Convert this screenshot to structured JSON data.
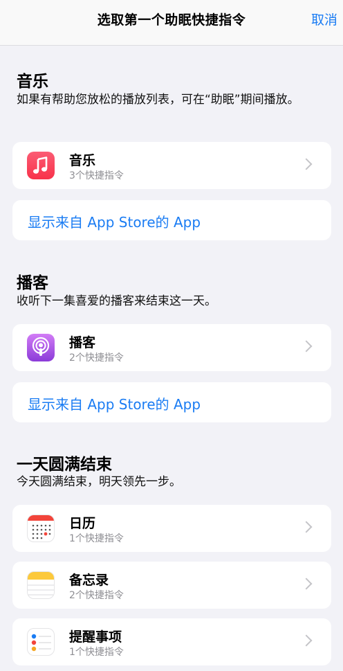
{
  "nav": {
    "title": "选取第一个助眠快捷指令",
    "cancel": "取消"
  },
  "sections": [
    {
      "title": "音乐",
      "description": "如果有帮助您放松的播放列表，可在“助眠”期间播放。",
      "app": {
        "name": "音乐",
        "subtitle": "3个快捷指令",
        "icon": "music-icon"
      },
      "link": "显示来自 App Store的 App"
    },
    {
      "title": "播客",
      "description": "收听下一集喜爱的播客来结束这一天。",
      "app": {
        "name": "播客",
        "subtitle": "2个快捷指令",
        "icon": "podcast-icon"
      },
      "link": "显示来自 App Store的 App"
    },
    {
      "title": "一天圆满结束",
      "description": "今天圆满结束，明天领先一步。",
      "apps": [
        {
          "name": "日历",
          "subtitle": "1个快捷指令",
          "icon": "calendar-icon"
        },
        {
          "name": "备忘录",
          "subtitle": "2个快捷指令",
          "icon": "notes-icon"
        },
        {
          "name": "提醒事项",
          "subtitle": "1个快捷指令",
          "icon": "reminders-icon"
        }
      ]
    }
  ],
  "colors": {
    "accent": "#1a7cf3",
    "background": "#f2f2f7",
    "card": "#ffffff",
    "secondary_text": "#8e8e93"
  }
}
